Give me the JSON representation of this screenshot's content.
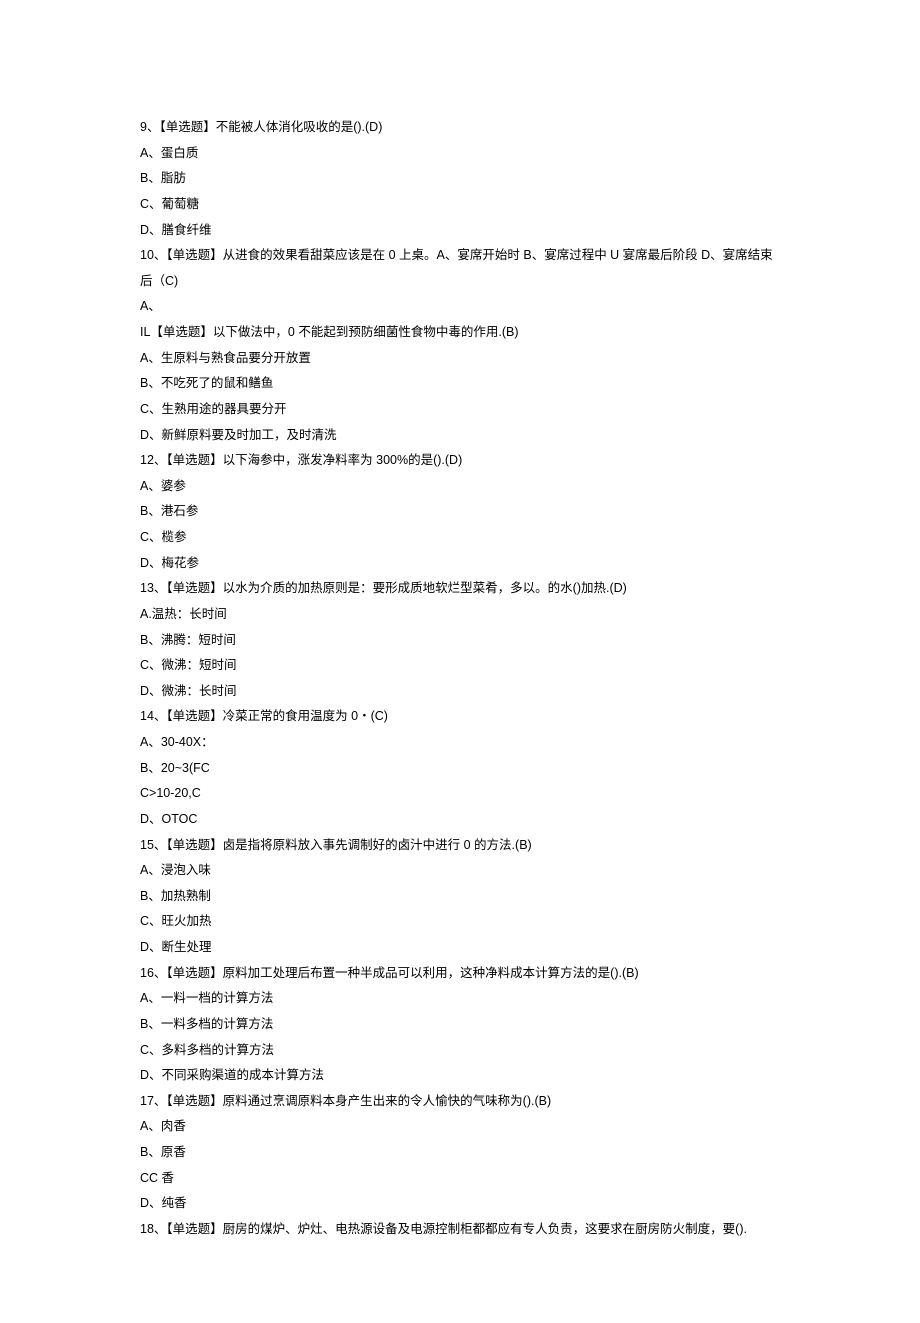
{
  "lines": [
    "9、【单选题】不能被人体消化吸收的是().(D)",
    "A、蛋白质",
    "B、脂肪",
    "C、葡萄糖",
    "D、膳食纤维",
    "10、【单选题】从进食的效果看甜菜应该是在 0 上桌。A、宴席开始时 B、宴席过程中 U 宴席最后阶段 D、宴席结束后（C)",
    "A、",
    "IL【单选题】以下做法中，0 不能起到预防细菌性食物中毒的作用.(B)",
    "A、生原料与熟食品要分开放置",
    "B、不吃死了的鼠和鳝鱼",
    "C、生熟用途的器具要分开",
    "D、新鲜原料要及时加工，及时清洗",
    "12、【单选题】以下海参中，涨发净料率为 300%的是().(D)",
    "A、婆参",
    "B、港石参",
    "C、榄参",
    "D、梅花参",
    "13、【单选题】以水为介质的加热原则是：要形成质地软烂型菜肴，多以。的水()加热.(D)",
    "A.温热：长时间",
    "B、沸腾：短时间",
    "C、微沸：短时间",
    "D、微沸：长时间",
    "14、【单选题】冷菜正常的食用温度为 0・(C)",
    "A、30-40X：",
    "B、20~3(FC",
    "C>10-20,C",
    "D、OTOC",
    "15、【单选题】卤是指将原料放入事先调制好的卤汁中进行 0 的方法.(B)",
    "A、浸泡入味",
    "B、加热熟制",
    "C、旺火加热",
    "D、断生处理",
    "16、【单选题】原料加工处理后布置一种半成品可以利用，这种净料成本计算方法的是().(B)",
    "A、一料一档的计算方法",
    "B、一料多档的计算方法",
    "C、多料多档的计算方法",
    "D、不同采购渠道的成本计算方法",
    "17、【单选题】原料通过烹调原料本身产生出来的令人愉快的气味称为().(B)",
    "A、肉香",
    "B、原香",
    "CC 香",
    "D、纯香",
    "18、【单选题】厨房的煤炉、炉灶、电热源设备及电源控制柜都都应有专人负责，这要求在厨房防火制度，要()."
  ]
}
